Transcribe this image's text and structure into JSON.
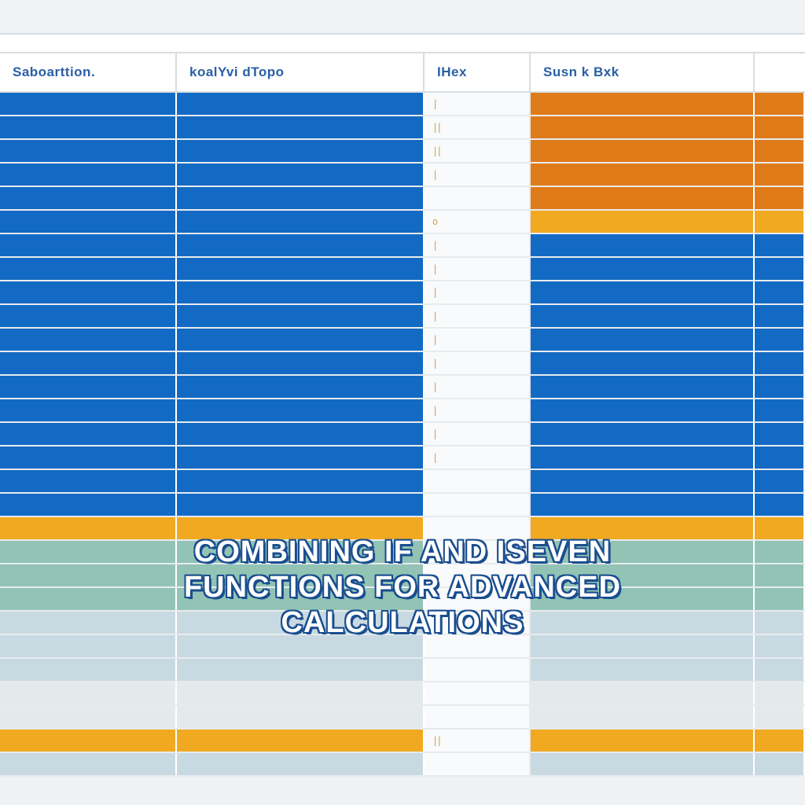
{
  "top": {
    "f1": "",
    "f2": "",
    "f3": "",
    "f4": ""
  },
  "headers": {
    "a": "Saboarttion.",
    "b": "koalYvi dTopo",
    "c": "IHex",
    "d": "Susn k Bxk",
    "e": ""
  },
  "overlay_title": "COMBINING IF AND ISEVEN FUNCTIONS FOR ADVANCED CALCULATIONS",
  "colors": {
    "blue": "#136ac4",
    "orange": "#e07b1a",
    "amber": "#f0a920",
    "teal": "#92c3b4",
    "pale": "#c9d9e2",
    "gray": "#e4e9ec"
  },
  "rows": [
    {
      "left": "blue",
      "right": "orange",
      "tick": "|"
    },
    {
      "left": "blue",
      "right": "orange",
      "tick": "||"
    },
    {
      "left": "blue",
      "right": "orange",
      "tick": "||"
    },
    {
      "left": "blue",
      "right": "orange",
      "tick": "|"
    },
    {
      "left": "blue",
      "right": "orange",
      "tick": ""
    },
    {
      "left": "blue",
      "right": "amber",
      "tick": "o"
    },
    {
      "left": "blue",
      "right": "blue",
      "tick": "|"
    },
    {
      "left": "blue",
      "right": "blue",
      "tick": "|"
    },
    {
      "left": "blue",
      "right": "blue",
      "tick": "|"
    },
    {
      "left": "blue",
      "right": "blue",
      "tick": "|"
    },
    {
      "left": "blue",
      "right": "blue",
      "tick": "|"
    },
    {
      "left": "blue",
      "right": "blue",
      "tick": "|"
    },
    {
      "left": "blue",
      "right": "blue",
      "tick": "|"
    },
    {
      "left": "blue",
      "right": "blue",
      "tick": "|"
    },
    {
      "left": "blue",
      "right": "blue",
      "tick": "|"
    },
    {
      "left": "blue",
      "right": "blue",
      "tick": "|"
    },
    {
      "left": "blue",
      "right": "blue",
      "tick": ""
    },
    {
      "left": "blue",
      "right": "blue",
      "tick": ""
    },
    {
      "left": "amber",
      "right": "amber",
      "tick": ""
    },
    {
      "left": "teal",
      "right": "teal",
      "tick": ""
    },
    {
      "left": "teal",
      "right": "teal",
      "tick": ""
    },
    {
      "left": "teal",
      "right": "teal",
      "tick": ""
    },
    {
      "left": "pale",
      "right": "pale",
      "tick": ""
    },
    {
      "left": "pale",
      "right": "pale",
      "tick": ""
    },
    {
      "left": "pale",
      "right": "pale",
      "tick": ""
    },
    {
      "left": "gray",
      "right": "gray",
      "tick": ""
    },
    {
      "left": "gray",
      "right": "gray",
      "tick": ""
    },
    {
      "left": "amber",
      "right": "amber",
      "tick": "||"
    },
    {
      "left": "pale",
      "right": "pale",
      "tick": ""
    }
  ]
}
